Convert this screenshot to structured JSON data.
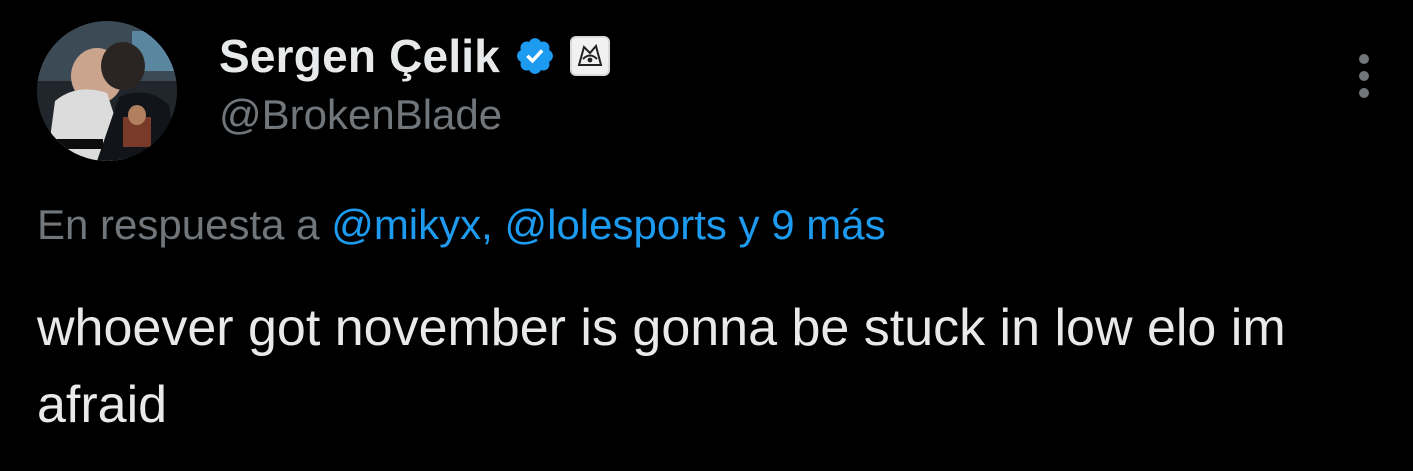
{
  "tweet": {
    "author": {
      "display_name": "Sergen Çelik",
      "handle": "@BrokenBlade",
      "verified_icon": "verified-badge-icon",
      "affiliation_icon": "team-logo-icon"
    },
    "reply_context": {
      "prefix": "En respuesta a",
      "mentions": "@mikyx, @lolesports y 9 más"
    },
    "text": "whoever got november is gonna be stuck in low elo im afraid",
    "more_icon": "more-options-icon"
  },
  "colors": {
    "background": "#000000",
    "primary_text": "#e7e9ea",
    "secondary_text": "#71767b",
    "accent": "#1d9bf0"
  }
}
